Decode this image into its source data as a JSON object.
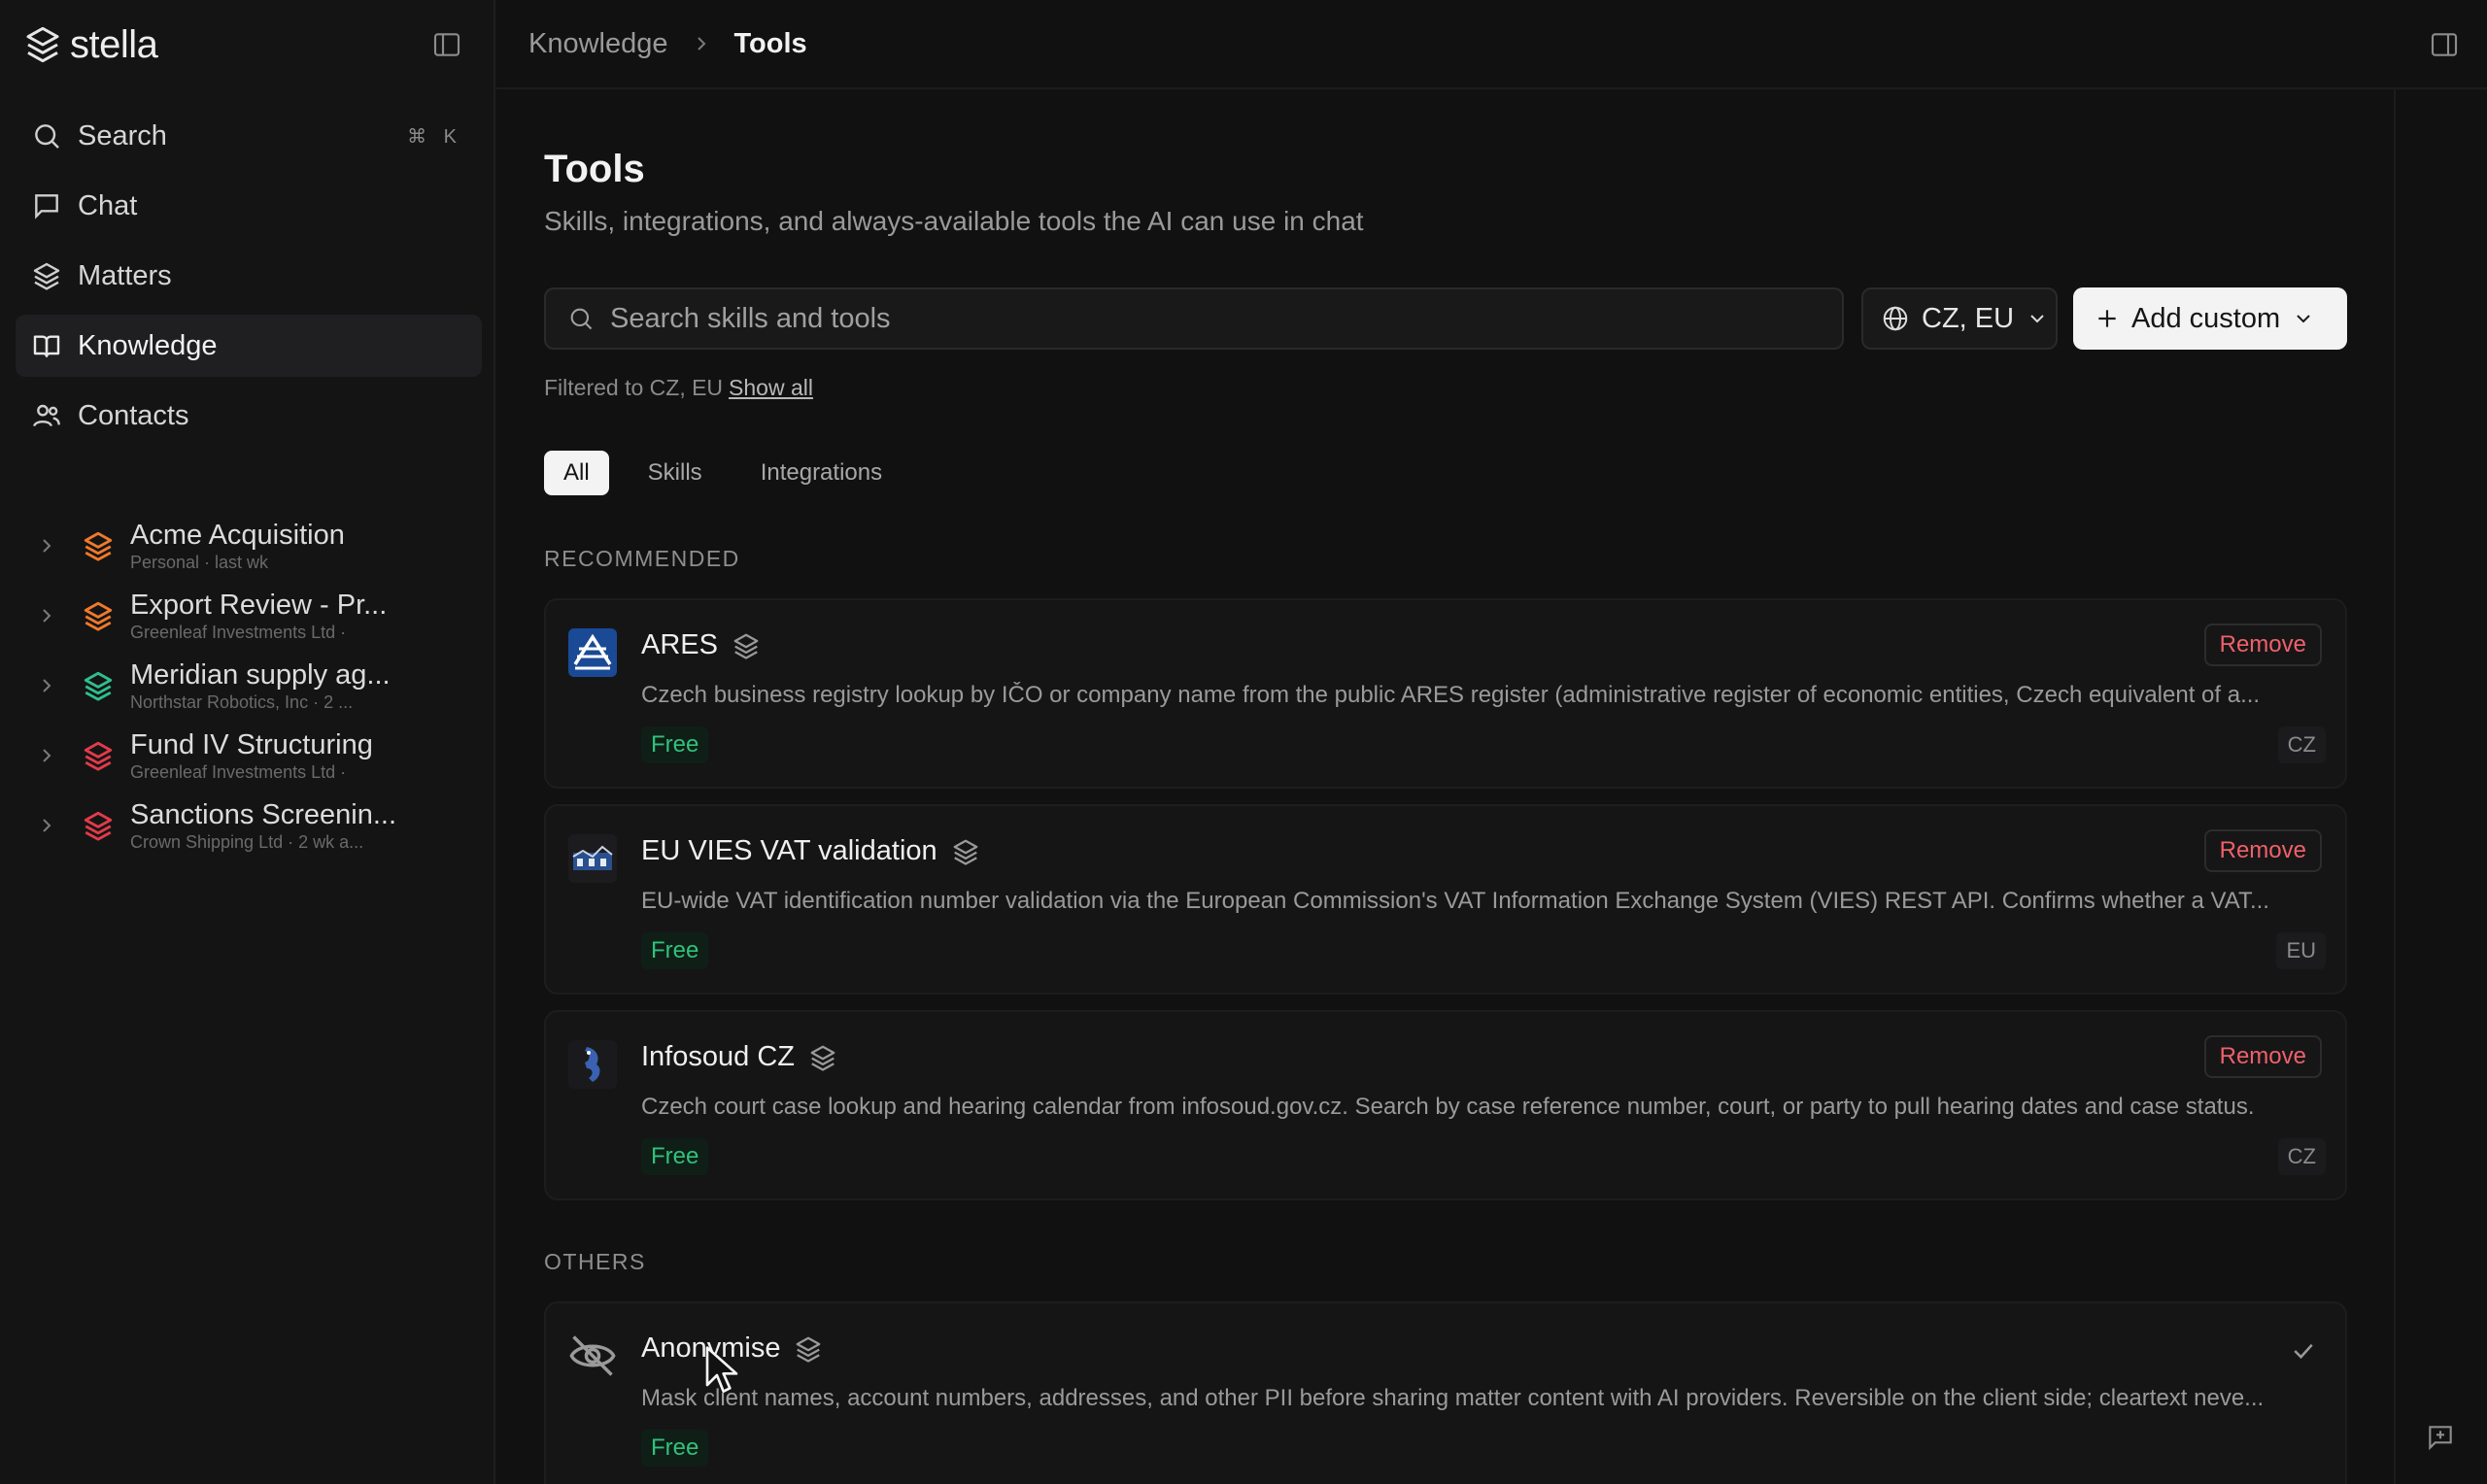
{
  "app": {
    "name": "stella"
  },
  "sidebar": {
    "nav": [
      {
        "label": "Search",
        "shortcut": "⌘ K",
        "icon": "search-icon"
      },
      {
        "label": "Chat",
        "icon": "chat-icon"
      },
      {
        "label": "Matters",
        "icon": "layers-icon"
      },
      {
        "label": "Knowledge",
        "icon": "book-icon",
        "active": true
      },
      {
        "label": "Contacts",
        "icon": "users-icon"
      }
    ],
    "matters": [
      {
        "title": "Acme Acquisition",
        "meta": "Personal · last wk",
        "color": "#f07a2a"
      },
      {
        "title": "Export Review - Pr...",
        "meta": "Greenleaf Investments Ltd ·",
        "color": "#f07a2a"
      },
      {
        "title": "Meridian supply ag...",
        "meta": "Northstar Robotics, Inc · 2 ...",
        "color": "#2fbf8f"
      },
      {
        "title": "Fund IV Structuring",
        "meta": "Greenleaf Investments Ltd ·",
        "color": "#e23b4a"
      },
      {
        "title": "Sanctions Screenin...",
        "meta": "Crown Shipping Ltd · 2 wk a...",
        "color": "#e23b4a"
      }
    ]
  },
  "breadcrumb": {
    "parent": "Knowledge",
    "current": "Tools"
  },
  "page": {
    "title": "Tools",
    "subtitle": "Skills, integrations, and always-available tools the AI can use in chat"
  },
  "search": {
    "placeholder": "Search skills and tools",
    "value": ""
  },
  "region_filter": {
    "label": "CZ, EU"
  },
  "add_button": {
    "label": "Add custom"
  },
  "filter_note": {
    "text": "Filtered to CZ, EU",
    "link": "Show all"
  },
  "tabs": [
    {
      "label": "All",
      "active": true
    },
    {
      "label": "Skills"
    },
    {
      "label": "Integrations"
    }
  ],
  "sections": {
    "recommended": "RECOMMENDED",
    "others": "OTHERS"
  },
  "tools": [
    {
      "name": "ARES",
      "desc": "Czech business registry lookup by IČO or company name from the public ARES register (administrative register of economic entities, Czech equivalent of a...",
      "price": "Free",
      "region": "CZ",
      "action": "Remove"
    },
    {
      "name": "EU VIES VAT validation",
      "desc": "EU-wide VAT identification number validation via the European Commission's VAT Information Exchange System (VIES) REST API. Confirms whether a VAT...",
      "price": "Free",
      "region": "EU",
      "action": "Remove"
    },
    {
      "name": "Infosoud CZ",
      "desc": "Czech court case lookup and hearing calendar from infosoud.gov.cz. Search by case reference number, court, or party to pull hearing dates and case status.",
      "price": "Free",
      "region": "CZ",
      "action": "Remove"
    },
    {
      "name": "Anonymise",
      "desc": "Mask client names, account numbers, addresses, and other PII before sharing matter content with AI providers. Reversible on the client side; cleartext neve...",
      "price": "Free"
    }
  ],
  "colors": {
    "background": "#111112",
    "accent_free": "#2fc27a",
    "remove": "#f0606a"
  }
}
